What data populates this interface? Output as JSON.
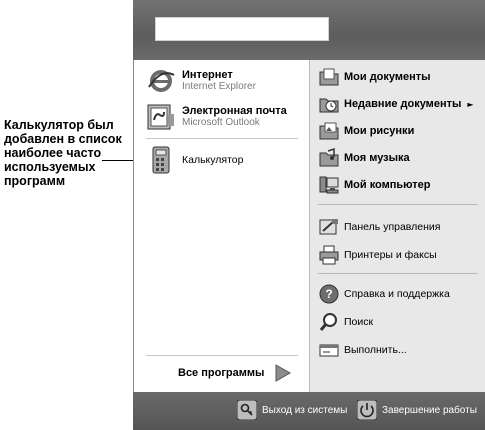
{
  "callout": {
    "lines": [
      "Калькулятор был",
      "добавлен в список",
      "наиболее часто",
      "используемых",
      "программ"
    ]
  },
  "pinned": [
    {
      "title": "Интернет",
      "subtitle": "Internet Explorer",
      "icon": "internet-explorer-icon"
    },
    {
      "title": "Электронная почта",
      "subtitle": "Microsoft Outlook",
      "icon": "outlook-icon"
    }
  ],
  "recent": [
    {
      "label": "Калькулятор",
      "icon": "calculator-icon"
    }
  ],
  "all_programs": {
    "label": "Все программы",
    "icon": "green-arrow-right-icon"
  },
  "right_items": [
    {
      "label": "Мои документы",
      "icon": "my-documents-icon",
      "bold": true
    },
    {
      "label": "Недавние документы",
      "icon": "recent-documents-icon",
      "bold": true,
      "submenu": "►"
    },
    {
      "label": "Мои рисунки",
      "icon": "my-pictures-icon",
      "bold": true
    },
    {
      "label": "Моя музыка",
      "icon": "my-music-icon",
      "bold": true
    },
    {
      "label": "Мой компьютер",
      "icon": "my-computer-icon",
      "bold": true
    },
    {
      "label": "Панель управления",
      "icon": "control-panel-icon",
      "bold": false
    },
    {
      "label": "Принтеры и факсы",
      "icon": "printers-icon",
      "bold": false
    },
    {
      "label": "Справка и поддержка",
      "icon": "help-icon",
      "bold": false
    },
    {
      "label": "Поиск",
      "icon": "search-icon",
      "bold": false
    },
    {
      "label": "Выполнить...",
      "icon": "run-icon",
      "bold": false
    }
  ],
  "footer": {
    "logoff_label": "Выход из системы",
    "shutdown_label": "Завершение работы"
  }
}
